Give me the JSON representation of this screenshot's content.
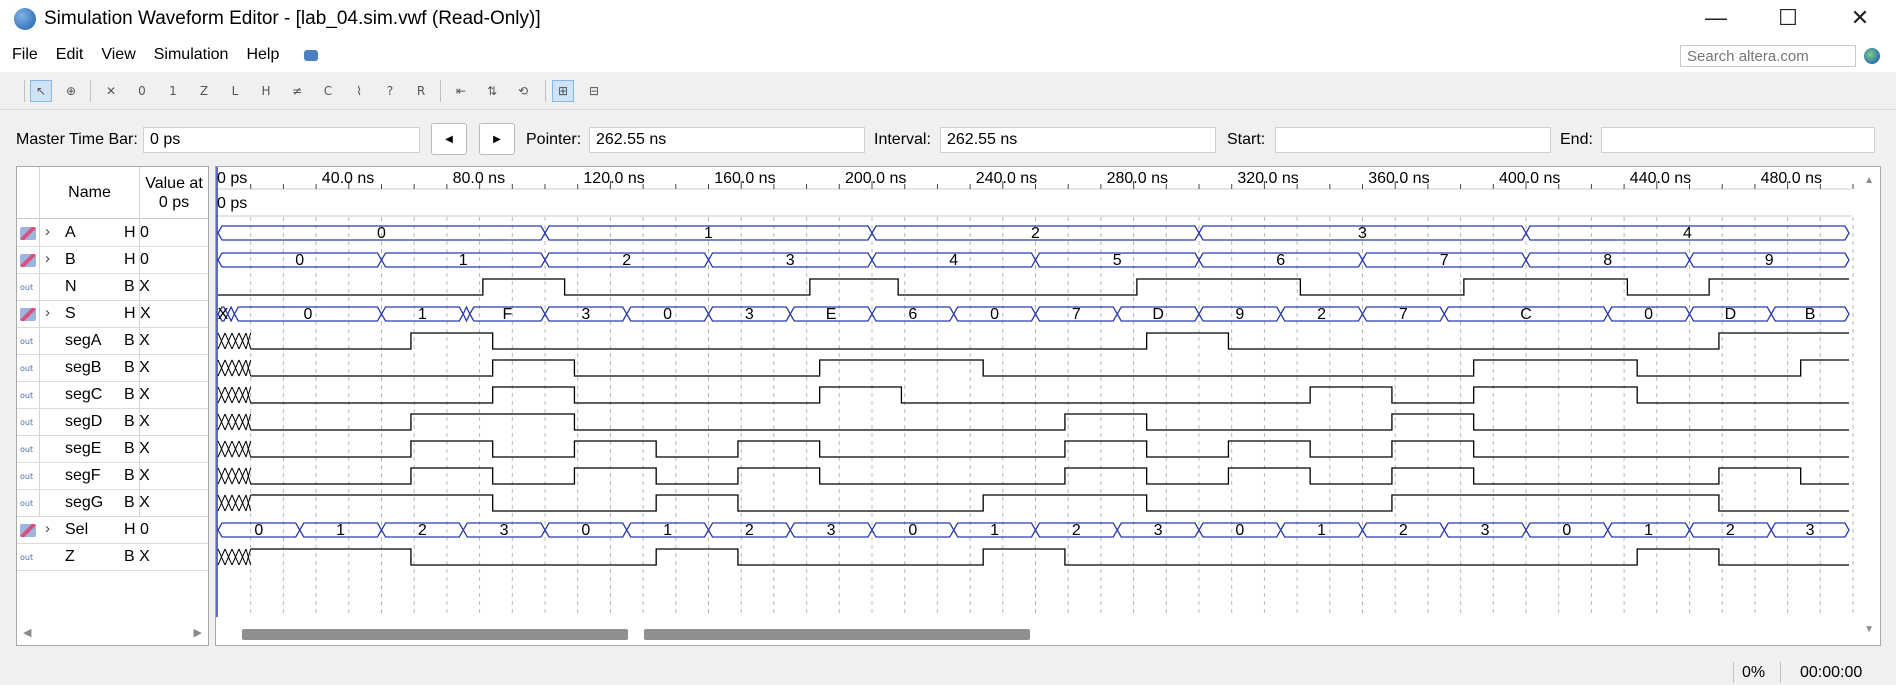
{
  "window": {
    "title": "Simulation Waveform Editor - [lab_04.sim.vwf (Read-Only)]",
    "minimize_glyph": "—",
    "maximize_glyph": "☐",
    "close_glyph": "✕"
  },
  "menu": [
    "File",
    "Edit",
    "View",
    "Simulation",
    "Help"
  ],
  "search": {
    "placeholder": "Search altera.com"
  },
  "toolbar_tools": [
    "selection-tool",
    "zoom-tool",
    "force-unknown",
    "force-low",
    "force-high",
    "force-high-impedance",
    "force-weak-low",
    "force-weak-high",
    "invert",
    "count-value",
    "clock",
    "random-values",
    "overwrite-value",
    "snap-to-grid-toggle",
    "sort-toggle",
    "reset-toggle",
    "grid-toggle",
    "group-toggle"
  ],
  "timebar": {
    "master_label": "Master Time Bar:",
    "master_value": "0 ps",
    "prev_glyph": "◀",
    "next_glyph": "▶",
    "pointer_label": "Pointer:",
    "pointer_value": "262.55 ns",
    "interval_label": "Interval:",
    "interval_value": "262.55 ns",
    "start_label": "Start:",
    "start_value": "",
    "end_label": "End:",
    "end_value": ""
  },
  "columns": {
    "name": "Name",
    "value_at_line1": "Value at",
    "value_at_line2": "0 ps"
  },
  "signals": [
    {
      "name": "A",
      "value": "H 0",
      "kind": "bus"
    },
    {
      "name": "B",
      "value": "H 0",
      "kind": "bus"
    },
    {
      "name": "N",
      "value": "B X",
      "kind": "out"
    },
    {
      "name": "S",
      "value": "H X",
      "kind": "bus"
    },
    {
      "name": "segA",
      "value": "B X",
      "kind": "out"
    },
    {
      "name": "segB",
      "value": "B X",
      "kind": "out"
    },
    {
      "name": "segC",
      "value": "B X",
      "kind": "out"
    },
    {
      "name": "segD",
      "value": "B X",
      "kind": "out"
    },
    {
      "name": "segE",
      "value": "B X",
      "kind": "out"
    },
    {
      "name": "segF",
      "value": "B X",
      "kind": "out"
    },
    {
      "name": "segG",
      "value": "B X",
      "kind": "out"
    },
    {
      "name": "Sel",
      "value": "H 0",
      "kind": "bus"
    },
    {
      "name": "Z",
      "value": "B X",
      "kind": "out"
    }
  ],
  "out_icon_text": "out",
  "time_ruler": {
    "ticks": [
      "0 ps",
      "40.0 ns",
      "80.0 ns",
      "120.0 ns",
      "160.0 ns",
      "200.0 ns",
      "240.0 ns",
      "280.0 ns",
      "320.0 ns",
      "360.0 ns",
      "400.0 ns",
      "440.0 ns",
      "480.0 ns"
    ],
    "cursor_label": "0 ps"
  },
  "waveforms": {
    "time_unit": "ns",
    "visible_end": 500,
    "bus": {
      "A": [
        [
          0,
          100,
          "0"
        ],
        [
          100,
          200,
          "1"
        ],
        [
          200,
          300,
          "2"
        ],
        [
          300,
          400,
          "3"
        ],
        [
          400,
          500,
          "4"
        ]
      ],
      "B": [
        [
          0,
          50,
          "0"
        ],
        [
          50,
          100,
          "1"
        ],
        [
          100,
          150,
          "2"
        ],
        [
          150,
          200,
          "3"
        ],
        [
          200,
          250,
          "4"
        ],
        [
          250,
          300,
          "5"
        ],
        [
          300,
          350,
          "6"
        ],
        [
          350,
          400,
          "7"
        ],
        [
          400,
          450,
          "8"
        ],
        [
          450,
          500,
          "9"
        ]
      ],
      "S": [
        [
          0,
          3,
          "X"
        ],
        [
          3,
          5,
          ""
        ],
        [
          5,
          50,
          "0"
        ],
        [
          50,
          75,
          "1"
        ],
        [
          75,
          77,
          ""
        ],
        [
          77,
          100,
          "F"
        ],
        [
          100,
          125,
          "3"
        ],
        [
          125,
          150,
          "0"
        ],
        [
          150,
          175,
          "3"
        ],
        [
          175,
          200,
          "E"
        ],
        [
          200,
          225,
          "6"
        ],
        [
          225,
          250,
          "0"
        ],
        [
          250,
          275,
          "7"
        ],
        [
          275,
          300,
          "D"
        ],
        [
          300,
          325,
          "9"
        ],
        [
          325,
          350,
          "2"
        ],
        [
          350,
          375,
          "7"
        ],
        [
          375,
          425,
          "C"
        ],
        [
          425,
          450,
          "0"
        ],
        [
          450,
          475,
          "D"
        ],
        [
          475,
          500,
          "B"
        ]
      ],
      "Sel": [
        [
          0,
          25,
          "0"
        ],
        [
          25,
          50,
          "1"
        ],
        [
          50,
          75,
          "2"
        ],
        [
          75,
          100,
          "3"
        ],
        [
          100,
          125,
          "0"
        ],
        [
          125,
          150,
          "1"
        ],
        [
          150,
          175,
          "2"
        ],
        [
          175,
          200,
          "3"
        ],
        [
          200,
          225,
          "0"
        ],
        [
          225,
          250,
          "1"
        ],
        [
          250,
          275,
          "2"
        ],
        [
          275,
          300,
          "3"
        ],
        [
          300,
          325,
          "0"
        ],
        [
          325,
          350,
          "1"
        ],
        [
          350,
          375,
          "2"
        ],
        [
          375,
          400,
          "3"
        ],
        [
          400,
          425,
          "0"
        ],
        [
          425,
          450,
          "1"
        ],
        [
          450,
          475,
          "2"
        ],
        [
          475,
          500,
          "3"
        ]
      ]
    },
    "bit": {
      "N": [
        [
          0,
          0
        ],
        [
          81,
          1
        ],
        [
          106,
          0
        ],
        [
          181,
          1
        ],
        [
          208,
          0
        ],
        [
          281,
          1
        ],
        [
          331,
          0
        ],
        [
          381,
          1
        ],
        [
          431,
          0
        ],
        [
          456,
          1
        ]
      ],
      "segA": [
        [
          10,
          0
        ],
        [
          59,
          1
        ],
        [
          84,
          0
        ],
        [
          284,
          1
        ],
        [
          309,
          0
        ],
        [
          459,
          1
        ]
      ],
      "segB": [
        [
          10,
          0
        ],
        [
          84,
          1
        ],
        [
          109,
          0
        ],
        [
          184,
          1
        ],
        [
          234,
          0
        ],
        [
          384,
          1
        ],
        [
          434,
          0
        ],
        [
          484,
          1
        ]
      ],
      "segC": [
        [
          10,
          0
        ],
        [
          84,
          1
        ],
        [
          109,
          0
        ],
        [
          184,
          1
        ],
        [
          209,
          0
        ],
        [
          334,
          1
        ],
        [
          359,
          0
        ],
        [
          384,
          1
        ],
        [
          434,
          0
        ]
      ],
      "segD": [
        [
          10,
          0
        ],
        [
          59,
          1
        ],
        [
          109,
          0
        ],
        [
          259,
          1
        ],
        [
          284,
          0
        ],
        [
          359,
          1
        ],
        [
          384,
          0
        ]
      ],
      "segE": [
        [
          10,
          0
        ],
        [
          59,
          1
        ],
        [
          84,
          0
        ],
        [
          109,
          1
        ],
        [
          134,
          0
        ],
        [
          159,
          1
        ],
        [
          184,
          0
        ],
        [
          259,
          1
        ],
        [
          284,
          0
        ],
        [
          309,
          1
        ],
        [
          334,
          0
        ],
        [
          359,
          1
        ],
        [
          384,
          0
        ]
      ],
      "segF": [
        [
          10,
          0
        ],
        [
          59,
          1
        ],
        [
          84,
          0
        ],
        [
          109,
          1
        ],
        [
          134,
          0
        ],
        [
          159,
          1
        ],
        [
          184,
          0
        ],
        [
          259,
          1
        ],
        [
          284,
          0
        ],
        [
          309,
          1
        ],
        [
          334,
          0
        ],
        [
          359,
          1
        ],
        [
          384,
          0
        ],
        [
          459,
          1
        ],
        [
          484,
          0
        ]
      ],
      "segG": [
        [
          10,
          1
        ],
        [
          84,
          0
        ],
        [
          134,
          1
        ],
        [
          159,
          0
        ],
        [
          234,
          1
        ],
        [
          284,
          0
        ],
        [
          359,
          1
        ],
        [
          459,
          0
        ]
      ],
      "Z": [
        [
          10,
          1
        ],
        [
          59,
          0
        ],
        [
          134,
          1
        ],
        [
          159,
          0
        ],
        [
          234,
          1
        ],
        [
          259,
          0
        ],
        [
          434,
          1
        ],
        [
          459,
          0
        ]
      ]
    }
  },
  "status": {
    "progress": "0%",
    "elapsed": "00:00:00"
  }
}
